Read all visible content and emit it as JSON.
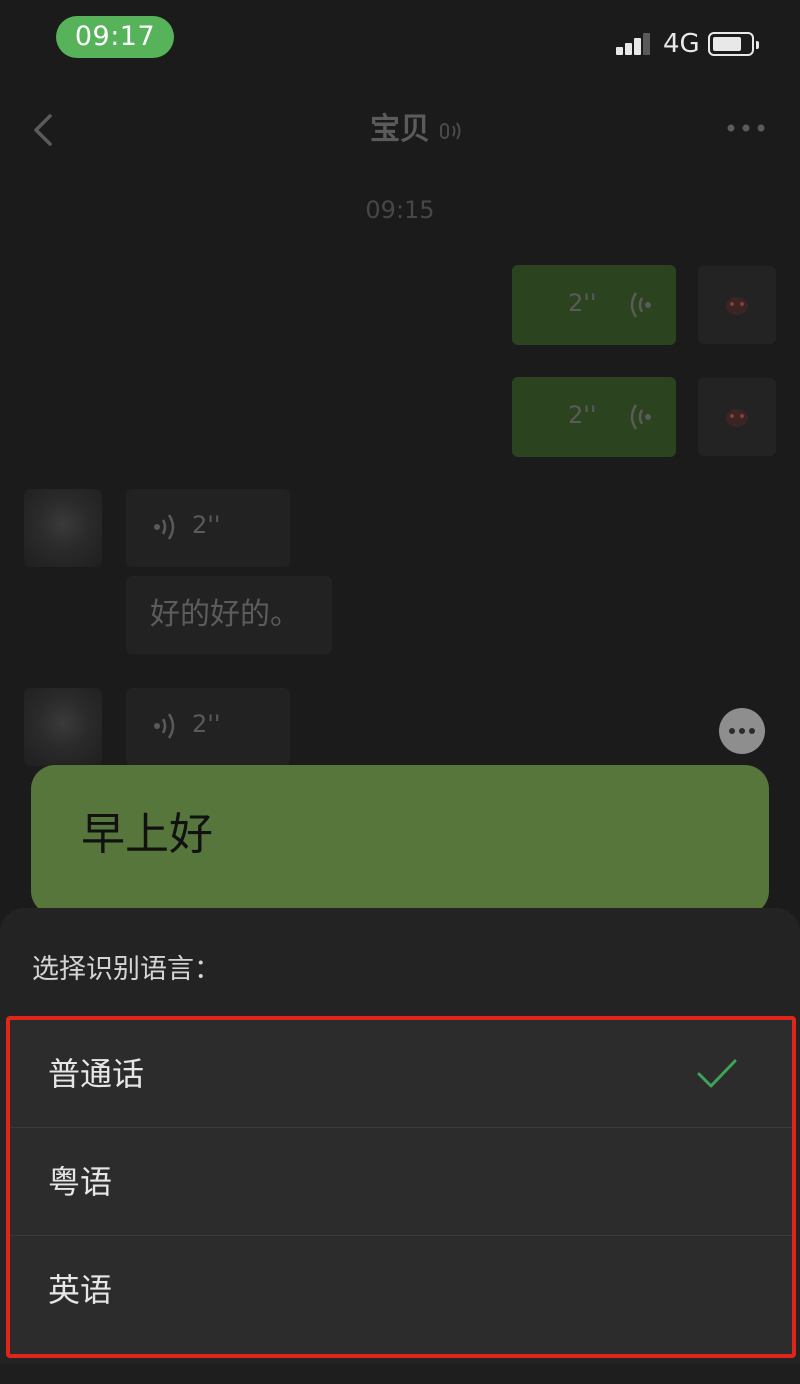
{
  "status_bar": {
    "time": "09:17",
    "network": "4G",
    "signal_icon": "cellular-signal-icon",
    "battery_icon": "battery-icon"
  },
  "chat": {
    "title": "宝贝",
    "title_icon": "voice-mode-icon",
    "timestamp": "09:15",
    "messages": [
      {
        "from": "me",
        "type": "voice",
        "duration": "2''"
      },
      {
        "from": "me",
        "type": "voice",
        "duration": "2''"
      },
      {
        "from": "other",
        "type": "voice",
        "duration": "2''"
      },
      {
        "from": "other",
        "type": "text",
        "text": "好的好的。"
      },
      {
        "from": "other",
        "type": "voice",
        "duration": "2''"
      }
    ]
  },
  "transcription": {
    "text": "早上好"
  },
  "sheet": {
    "title": "选择识别语言：",
    "options": [
      {
        "label": "普通话",
        "selected": true
      },
      {
        "label": "粤语",
        "selected": false
      },
      {
        "label": "英语",
        "selected": false
      }
    ]
  },
  "colors": {
    "accent_green": "#57b35a",
    "transcription_bg": "#57763c",
    "highlight_border": "#e0251b",
    "check_color": "#3fa35a"
  }
}
